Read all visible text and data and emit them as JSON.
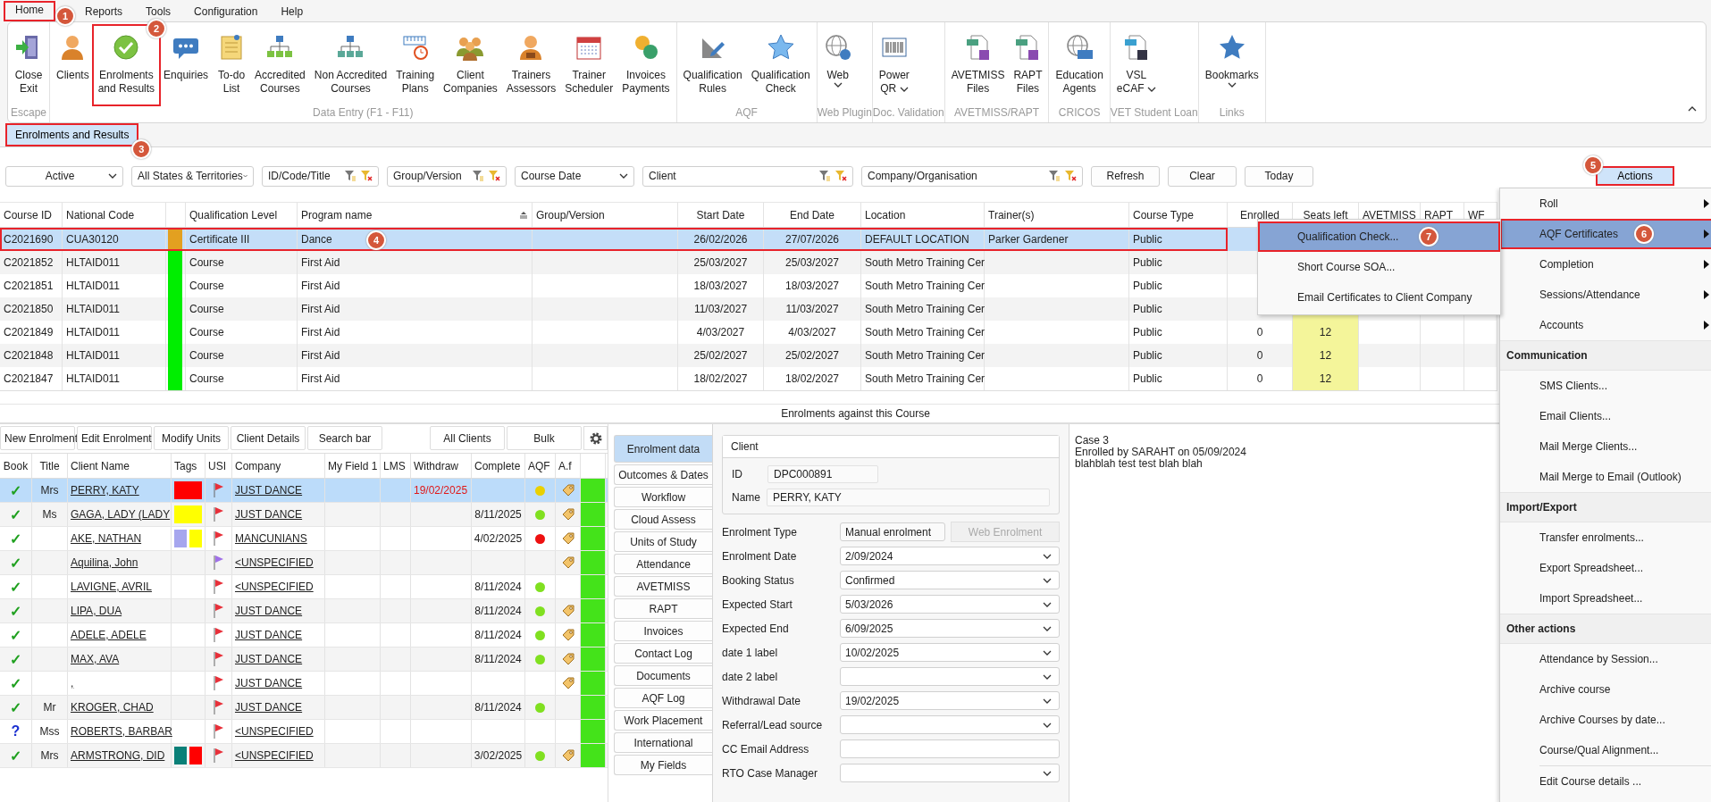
{
  "menu_tabs": [
    {
      "label": "Home",
      "selected": true,
      "callout": "1"
    },
    {
      "label": "Reports",
      "selected": false
    },
    {
      "label": "Tools",
      "selected": false
    },
    {
      "label": "Configuration",
      "selected": false
    },
    {
      "label": "Help",
      "selected": false
    }
  ],
  "ribbon": {
    "groups": [
      {
        "label": "Escape",
        "buttons": [
          {
            "lines": [
              "Close",
              "Exit"
            ],
            "dropdown": false
          }
        ]
      },
      {
        "label": "Data Entry (F1 - F11)",
        "buttons": [
          {
            "lines": [
              "Clients"
            ],
            "dropdown": false
          },
          {
            "lines": [
              "Enrolments",
              "and Results"
            ],
            "dropdown": false,
            "callout": "2"
          },
          {
            "lines": [
              "Enquiries"
            ],
            "dropdown": false
          },
          {
            "lines": [
              "To-do",
              "List"
            ],
            "dropdown": false
          },
          {
            "lines": [
              "Accredited",
              "Courses"
            ],
            "dropdown": false
          },
          {
            "lines": [
              "Non Accredited",
              "Courses"
            ],
            "dropdown": false
          },
          {
            "lines": [
              "Training",
              "Plans"
            ],
            "dropdown": false
          },
          {
            "lines": [
              "Client",
              "Companies"
            ],
            "dropdown": false
          },
          {
            "lines": [
              "Trainers",
              "Assessors"
            ],
            "dropdown": false
          },
          {
            "lines": [
              "Trainer",
              "Scheduler"
            ],
            "dropdown": false
          },
          {
            "lines": [
              "Invoices",
              "Payments"
            ],
            "dropdown": false
          }
        ]
      },
      {
        "label": "AQF",
        "buttons": [
          {
            "lines": [
              "Qualification",
              "Rules"
            ],
            "dropdown": false
          },
          {
            "lines": [
              "Qualification",
              "Check"
            ],
            "dropdown": false
          }
        ]
      },
      {
        "label": "Web Plugin",
        "buttons": [
          {
            "lines": [
              "Web"
            ],
            "dropdown": true
          }
        ]
      },
      {
        "label": "Doc. Validation",
        "buttons": [
          {
            "lines": [
              "Power",
              "QR"
            ],
            "dropdown": true
          }
        ]
      },
      {
        "label": "AVETMISS/RAPT",
        "buttons": [
          {
            "lines": [
              "AVETMISS",
              "Files"
            ],
            "dropdown": false
          },
          {
            "lines": [
              "RAPT",
              "Files"
            ],
            "dropdown": false
          }
        ]
      },
      {
        "label": "CRICOS",
        "buttons": [
          {
            "lines": [
              "Education",
              "Agents"
            ],
            "dropdown": false
          }
        ]
      },
      {
        "label": "VET Student Loan",
        "buttons": [
          {
            "lines": [
              "VSL",
              "eCAF"
            ],
            "dropdown": true
          }
        ]
      },
      {
        "label": "Links",
        "buttons": [
          {
            "lines": [
              "Bookmarks"
            ],
            "dropdown": true
          }
        ]
      }
    ]
  },
  "document_tabs": [
    {
      "label": "Enrolments and Results",
      "selected": true,
      "callout": "3"
    }
  ],
  "filters": [
    {
      "kind": "dropdown",
      "value": "Active"
    },
    {
      "kind": "dropdown",
      "value": "All States & Territories"
    },
    {
      "kind": "filter",
      "label": "ID/Code/Title"
    },
    {
      "kind": "filter",
      "label": "Group/Version"
    },
    {
      "kind": "dropdown",
      "value": "Course Date"
    },
    {
      "kind": "filter",
      "label": "Client"
    },
    {
      "kind": "filter",
      "label": "Company/Organisation"
    }
  ],
  "filter_buttons": [
    "Refresh",
    "Clear",
    "Today"
  ],
  "actions_button": {
    "label": "Actions",
    "callout": "5"
  },
  "courses": {
    "columns": [
      {
        "heading": "Course ID",
        "sorted": false
      },
      {
        "heading": "National Code",
        "sorted": false
      },
      {
        "heading": "Qualification Level",
        "sorted": false
      },
      {
        "heading": "Program name",
        "sorted": true
      },
      {
        "heading": "Group/Version",
        "sorted": false
      },
      {
        "heading": "Start Date",
        "sorted": false
      },
      {
        "heading": "End Date",
        "sorted": false
      },
      {
        "heading": "Location",
        "sorted": false
      },
      {
        "heading": "Trainer(s)",
        "sorted": false
      },
      {
        "heading": "Course Type",
        "sorted": false
      },
      {
        "heading": "Enrolled",
        "sorted": false
      },
      {
        "heading": "Seats left",
        "sorted": false
      },
      {
        "heading": "AVETMISS",
        "sorted": false
      },
      {
        "heading": "RAPT",
        "sorted": false
      },
      {
        "heading": "WF",
        "sorted": false
      }
    ],
    "rows": [
      {
        "course_id": "C2021690",
        "national_code": "CUA30120",
        "color": "#e3a020",
        "qualification_level": "Certificate III",
        "program_name": "Dance",
        "start_date": "26/02/2026",
        "end_date": "27/07/2026",
        "location": "DEFAULT LOCATION",
        "trainer": "Parker Gardener",
        "course_type": "Public",
        "selected": true,
        "callout": "4"
      },
      {
        "course_id": "C2021852",
        "national_code": "HLTAID011",
        "color": "#00ee00",
        "qualification_level": "Course",
        "program_name": "First Aid",
        "start_date": "25/03/2027",
        "end_date": "25/03/2027",
        "location": "South Metro Training Cer",
        "course_type": "Public",
        "selected": false
      },
      {
        "course_id": "C2021851",
        "national_code": "HLTAID011",
        "color": "#00ee00",
        "qualification_level": "Course",
        "program_name": "First Aid",
        "start_date": "18/03/2027",
        "end_date": "18/03/2027",
        "location": "South Metro Training Cer",
        "course_type": "Public",
        "selected": false
      },
      {
        "course_id": "C2021850",
        "national_code": "HLTAID011",
        "color": "#00ee00",
        "qualification_level": "Course",
        "program_name": "First Aid",
        "start_date": "11/03/2027",
        "end_date": "11/03/2027",
        "location": "South Metro Training Cer",
        "course_type": "Public",
        "selected": false
      },
      {
        "course_id": "C2021849",
        "national_code": "HLTAID011",
        "color": "#00ee00",
        "qualification_level": "Course",
        "program_name": "First Aid",
        "start_date": "4/03/2027",
        "end_date": "4/03/2027",
        "location": "South Metro Training Cer",
        "course_type": "Public",
        "enrolled": "0",
        "seats_left": "12",
        "selected": false
      },
      {
        "course_id": "C2021848",
        "national_code": "HLTAID011",
        "color": "#00ee00",
        "qualification_level": "Course",
        "program_name": "First Aid",
        "start_date": "25/02/2027",
        "end_date": "25/02/2027",
        "location": "South Metro Training Cer",
        "course_type": "Public",
        "enrolled": "0",
        "seats_left": "12",
        "selected": false
      },
      {
        "course_id": "C2021847",
        "national_code": "HLTAID011",
        "color": "#00ee00",
        "qualification_level": "Course",
        "program_name": "First Aid",
        "start_date": "18/02/2027",
        "end_date": "18/02/2027",
        "location": "South Metro Training Cer",
        "course_type": "Public",
        "enrolled": "0",
        "seats_left": "12",
        "selected": false
      }
    ]
  },
  "section_title": "Enrolments against this Course",
  "enrolment_toolbar": {
    "left": [
      "New Enrolment",
      "Edit Enrolment",
      "Modify Units",
      "Client Details",
      "Search bar"
    ],
    "right": [
      "All Clients",
      "Bulk"
    ]
  },
  "enrolments": {
    "columns": [
      "Book",
      "Title",
      "Client Name",
      "Tags",
      "USI",
      "Company",
      "My Field 1",
      "LMS",
      "Withdraw",
      "Complete",
      "AQF",
      "A.f"
    ],
    "rows": [
      {
        "book": {
          "mark": "✓",
          "color": "#1fa01f"
        },
        "title": "Mrs",
        "client": "PERRY, KATY",
        "tags": [
          {
            "color": "#ff0000"
          }
        ],
        "usi_flag": {
          "color": "#e8303a"
        },
        "company": "JUST DANCE",
        "withdraw": "19/02/2025",
        "aqf": {
          "color": "#ead000"
        },
        "af_tag": true,
        "status": {
          "color": "#44e31a"
        },
        "selected": true
      },
      {
        "book": {
          "mark": "✓",
          "color": "#1fa01f"
        },
        "title": "Ms",
        "client": "GAGA, LADY (LADY",
        "tags": [
          {
            "color": "#ffff00"
          }
        ],
        "usi_flag": {
          "color": "#e8303a"
        },
        "company": "JUST DANCE",
        "complete": "8/11/2025",
        "aqf": {
          "color": "#80e020"
        },
        "af_tag": true,
        "status": {
          "color": "#44e31a"
        },
        "selected": false
      },
      {
        "book": {
          "mark": "✓",
          "color": "#1fa01f"
        },
        "client": "AKE, NATHAN",
        "tags": [
          {
            "color": "#a6a6ee"
          },
          {
            "color": "#ffff00"
          }
        ],
        "usi_flag": {
          "color": "#e8303a"
        },
        "company": "MANCUNIANS",
        "complete": "4/02/2025",
        "aqf": {
          "color": "#ee1010"
        },
        "af_tag": true,
        "status": {
          "color": "#44e31a"
        },
        "selected": false
      },
      {
        "book": {
          "mark": "✓",
          "color": "#1fa01f"
        },
        "client": "Aquilina, John",
        "usi_flag": {
          "color": "#a070e8"
        },
        "company": "<UNSPECIFIED",
        "af_tag": true,
        "status": {
          "color": "#44e31a"
        },
        "selected": false
      },
      {
        "book": {
          "mark": "✓",
          "color": "#1fa01f"
        },
        "client": "LAVIGNE, AVRIL",
        "usi_flag": {
          "color": "#e8303a"
        },
        "company": "<UNSPECIFIED",
        "complete": "8/11/2024",
        "aqf": {
          "color": "#80e020"
        },
        "af_tag": false,
        "status": {
          "color": "#44e31a"
        },
        "selected": false
      },
      {
        "book": {
          "mark": "✓",
          "color": "#1fa01f"
        },
        "client": "LIPA, DUA",
        "usi_flag": {
          "color": "#e8303a"
        },
        "company": "JUST DANCE",
        "complete": "8/11/2024",
        "aqf": {
          "color": "#80e020"
        },
        "af_tag": true,
        "status": {
          "color": "#44e31a"
        },
        "selected": false
      },
      {
        "book": {
          "mark": "✓",
          "color": "#1fa01f"
        },
        "client": "ADELE, ADELE",
        "usi_flag": {
          "color": "#e8303a"
        },
        "company": "JUST DANCE",
        "complete": "8/11/2024",
        "aqf": {
          "color": "#80e020"
        },
        "af_tag": true,
        "status": {
          "color": "#44e31a"
        },
        "selected": false
      },
      {
        "book": {
          "mark": "✓",
          "color": "#1fa01f"
        },
        "client": "MAX, AVA",
        "usi_flag": {
          "color": "#e8303a"
        },
        "company": "JUST DANCE",
        "complete": "8/11/2024",
        "aqf": {
          "color": "#80e020"
        },
        "af_tag": true,
        "status": {
          "color": "#44e31a"
        },
        "selected": false
      },
      {
        "book": {
          "mark": "✓",
          "color": "#1fa01f"
        },
        "client": ",",
        "usi_flag": {
          "color": "#e8303a"
        },
        "company": "JUST DANCE",
        "af_tag": true,
        "status": {
          "color": "#44e31a"
        },
        "selected": false
      },
      {
        "book": {
          "mark": "✓",
          "color": "#1fa01f"
        },
        "title": "Mr",
        "client": "KROGER, CHAD",
        "usi_flag": {
          "color": "#e8303a"
        },
        "company": "JUST DANCE",
        "complete": "8/11/2024",
        "aqf": {
          "color": "#80e020"
        },
        "af_tag": false,
        "status": {
          "color": "#44e31a"
        },
        "selected": false
      },
      {
        "book": {
          "mark": "?",
          "color": "#1a2fd0"
        },
        "title": "Mss",
        "client": "ROBERTS, BARBAR",
        "usi_flag": {
          "color": "#e8303a"
        },
        "company": "<UNSPECIFIED",
        "af_tag": false,
        "status": {
          "color": "#44e31a"
        },
        "selected": false
      },
      {
        "book": {
          "mark": "✓",
          "color": "#1fa01f"
        },
        "title": "Mrs",
        "client": "ARMSTRONG, DID",
        "tags": [
          {
            "color": "#0a8078"
          },
          {
            "color": "#ff0000"
          }
        ],
        "usi_flag": {
          "color": "#e8303a"
        },
        "company": "<UNSPECIFIED",
        "complete": "3/02/2025",
        "aqf": {
          "color": "#80e020"
        },
        "af_tag": true,
        "status": {
          "color": "#44e31a"
        },
        "selected": false
      }
    ]
  },
  "detail_tabs": [
    {
      "label": "Enrolment data",
      "selected": true
    },
    {
      "label": "Outcomes & Dates",
      "selected": false
    },
    {
      "label": "Workflow",
      "selected": false
    },
    {
      "label": "Cloud Assess",
      "selected": false
    },
    {
      "label": "Units of Study",
      "selected": false
    },
    {
      "label": "Attendance",
      "selected": false
    },
    {
      "label": "AVETMISS",
      "selected": false
    },
    {
      "label": "RAPT",
      "selected": false
    },
    {
      "label": "Invoices",
      "selected": false
    },
    {
      "label": "Contact Log",
      "selected": false
    },
    {
      "label": "Documents",
      "selected": false
    },
    {
      "label": "AQF Log",
      "selected": false
    },
    {
      "label": "Work Placement",
      "selected": false
    },
    {
      "label": "International",
      "selected": false
    },
    {
      "label": "My Fields",
      "selected": false
    }
  ],
  "enrolment_form": {
    "client_group": {
      "title": "Client",
      "id_label": "ID",
      "id_value": "DPC000891",
      "name_label": "Name",
      "name_value": "PERRY, KATY"
    },
    "fields": [
      {
        "label": "Enrolment Type",
        "kind": "readonly",
        "value": "Manual enrolment",
        "button": {
          "label": "Web Enrolment",
          "disabled": true
        }
      },
      {
        "label": "Enrolment Date",
        "kind": "dropdown",
        "value": "2/09/2024"
      },
      {
        "label": "Booking Status",
        "kind": "dropdown",
        "value": "Confirmed"
      },
      {
        "label": "Expected Start",
        "kind": "dropdown",
        "value": "5/03/2026"
      },
      {
        "label": "Expected End",
        "kind": "dropdown",
        "value": "6/09/2025"
      },
      {
        "label": "date 1 label",
        "kind": "dropdown",
        "value": "10/02/2025"
      },
      {
        "label": "date 2 label",
        "kind": "dropdown"
      },
      {
        "label": "Withdrawal Date",
        "kind": "dropdown",
        "value": "19/02/2025"
      },
      {
        "label": "Referral/Lead source",
        "kind": "dropdown"
      },
      {
        "label": "CC Email Address",
        "kind": "text"
      },
      {
        "label": "RTO Case Manager",
        "kind": "dropdown"
      }
    ]
  },
  "notes": [
    "Case 3",
    "Enrolled by SARAHT on 05/09/2024",
    "blahblah test test blah blah"
  ],
  "actions_menu": [
    {
      "kind": "item",
      "label": "Roll",
      "submenu": true,
      "selected": false
    },
    {
      "kind": "item",
      "label": "AQF Certificates",
      "submenu": true,
      "selected": true,
      "callout": "6"
    },
    {
      "kind": "item",
      "label": "Completion",
      "submenu": true,
      "selected": false
    },
    {
      "kind": "item",
      "label": "Sessions/Attendance",
      "submenu": true,
      "selected": false
    },
    {
      "kind": "item",
      "label": "Accounts",
      "submenu": true,
      "selected": false
    },
    {
      "kind": "header",
      "label": "Communication"
    },
    {
      "kind": "item",
      "label": "SMS Clients...",
      "submenu": false,
      "selected": false
    },
    {
      "kind": "item",
      "label": "Email Clients...",
      "submenu": false,
      "selected": false
    },
    {
      "kind": "item",
      "label": "Mail Merge Clients...",
      "submenu": false,
      "selected": false
    },
    {
      "kind": "item",
      "label": "Mail Merge to Email (Outlook)",
      "submenu": false,
      "selected": false
    },
    {
      "kind": "header",
      "label": "Import/Export"
    },
    {
      "kind": "item",
      "label": "Transfer enrolments...",
      "submenu": false,
      "selected": false
    },
    {
      "kind": "item",
      "label": "Export Spreadsheet...",
      "submenu": false,
      "selected": false
    },
    {
      "kind": "item",
      "label": "Import Spreadsheet...",
      "submenu": false,
      "selected": false
    },
    {
      "kind": "header",
      "label": "Other actions"
    },
    {
      "kind": "item",
      "label": "Attendance by Session...",
      "submenu": false,
      "selected": false
    },
    {
      "kind": "item",
      "label": "Archive course",
      "submenu": false,
      "selected": false
    },
    {
      "kind": "item",
      "label": "Archive Courses by date...",
      "submenu": false,
      "selected": false
    },
    {
      "kind": "item",
      "label": "Course/Qual Alignment...",
      "submenu": false,
      "selected": false
    },
    {
      "kind": "separator"
    },
    {
      "kind": "item",
      "label": "Edit Course details ...",
      "submenu": false,
      "selected": false
    }
  ],
  "aqf_submenu": [
    {
      "label": "Qualification Check...",
      "selected": true,
      "callout": "7"
    },
    {
      "label": "Short Course SOA...",
      "selected": false
    },
    {
      "label": "Email Certificates to Client Company",
      "selected": false
    }
  ]
}
